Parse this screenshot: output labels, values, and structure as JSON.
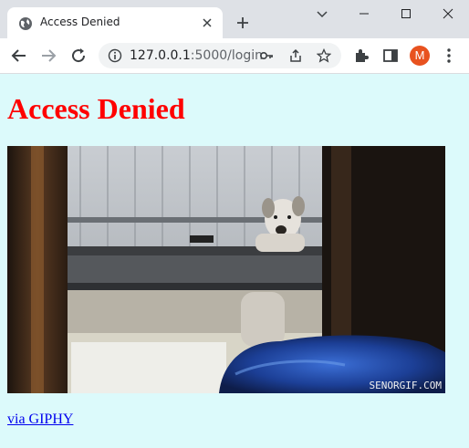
{
  "browser": {
    "tab_title": "Access Denied",
    "url_host": "127.0.0.1",
    "url_path": ":5000/login",
    "profile_initial": "M",
    "profile_color": "#e8521f",
    "icons": [
      "globe-icon",
      "close-icon",
      "plus-icon",
      "chevron-down-icon",
      "minimize-icon",
      "maximize-icon",
      "window-close-icon",
      "back-icon",
      "forward-icon",
      "reload-icon",
      "info-icon",
      "key-icon",
      "share-icon",
      "star-icon",
      "extensions-icon",
      "side-panel-icon",
      "more-icon"
    ]
  },
  "page": {
    "background": "#dcfafb",
    "heading": "Access Denied",
    "heading_color": "#ff0000",
    "gif_watermark": "SENORGIF.COM",
    "link_text": "via GIPHY"
  }
}
